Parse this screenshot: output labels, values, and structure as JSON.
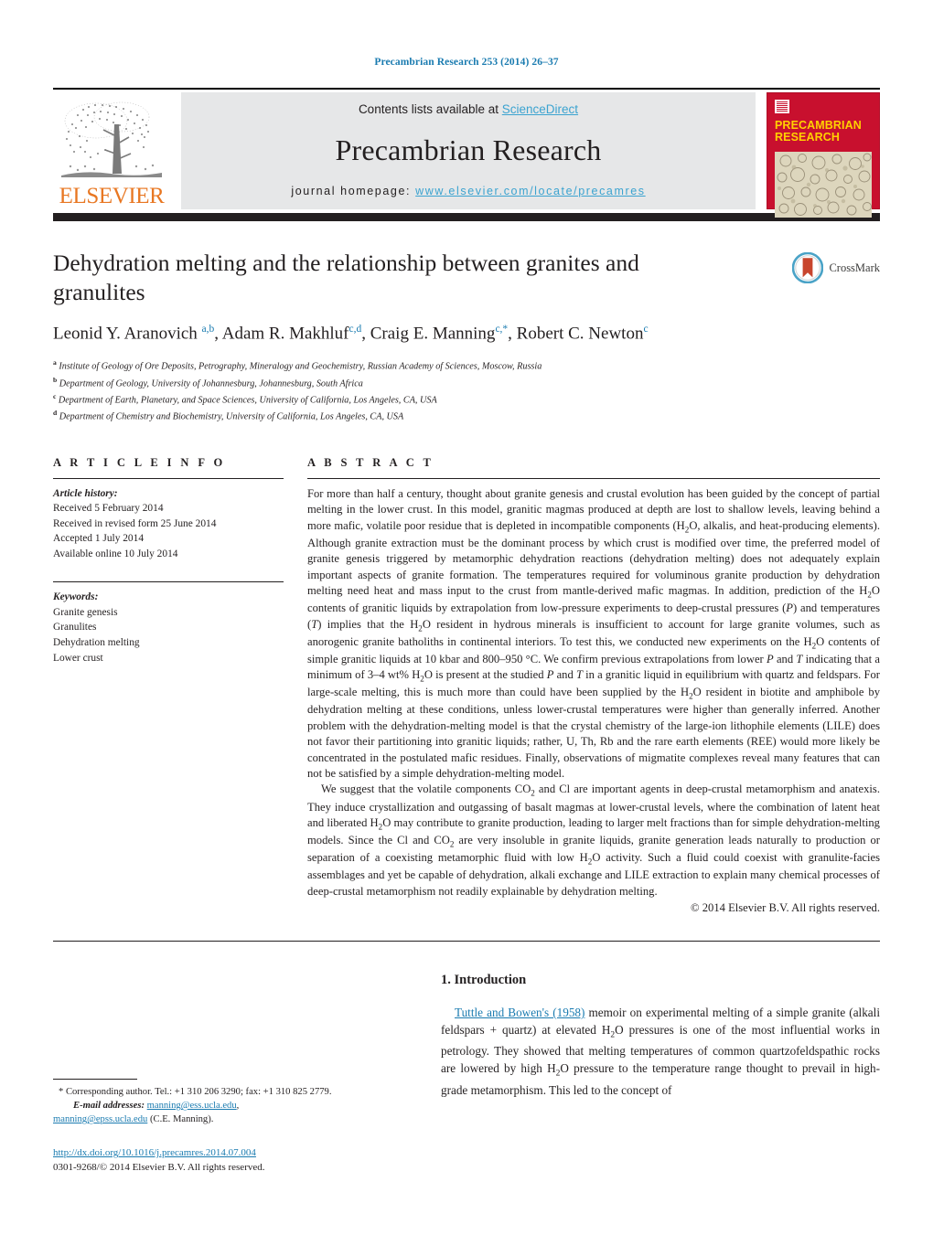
{
  "running_head": "Precambrian Research 253 (2014) 26–37",
  "masthead": {
    "publisher_name": "ELSEVIER",
    "contents_prefix": "Contents lists available at ",
    "sciencedirect_label": "ScienceDirect",
    "journal_title": "Precambrian Research",
    "homepage_prefix": "journal homepage: ",
    "homepage_url": "www.elsevier.com/locate/precamres",
    "cover_title_line1": "PRECAMBRIAN",
    "cover_title_line2": "RESEARCH",
    "colors": {
      "cover_red": "#c8102e",
      "cover_yellow": "#ffd100",
      "elsevier_orange": "#e87722",
      "link_blue": "#3ba3d0",
      "panel_gray": "#e6e7e8"
    }
  },
  "article": {
    "title": "Dehydration melting and the relationship between granites and granulites",
    "authors_html": "Leonid Y. Aranovich <sup>a,b</sup>, Adam R. Makhluf<sup>c,d</sup>, Craig E. Manning<sup>c,</sup><sup>*</sup>, Robert C. Newton<sup>c</sup>",
    "affiliations": [
      {
        "marker": "a",
        "text": "Institute of Geology of Ore Deposits, Petrography, Mineralogy and Geochemistry, Russian Academy of Sciences, Moscow, Russia"
      },
      {
        "marker": "b",
        "text": "Department of Geology, University of Johannesburg, Johannesburg, South Africa"
      },
      {
        "marker": "c",
        "text": "Department of Earth, Planetary, and Space Sciences, University of California, Los Angeles, CA, USA"
      },
      {
        "marker": "d",
        "text": "Department of Chemistry and Biochemistry, University of California, Los Angeles, CA, USA"
      }
    ],
    "crossmark_label": "CrossMark"
  },
  "article_info": {
    "kicker": "A R T I C L E   I N F O",
    "history_head": "Article history:",
    "history": [
      "Received 5 February 2014",
      "Received in revised form 25 June 2014",
      "Accepted 1 July 2014",
      "Available online 10 July 2014"
    ],
    "keywords_head": "Keywords:",
    "keywords": [
      "Granite genesis",
      "Granulites",
      "Dehydration melting",
      "Lower crust"
    ]
  },
  "abstract": {
    "kicker": "A B S T R A C T",
    "paragraph1_html": "For more than half a century, thought about granite genesis and crustal evolution has been guided by the concept of partial melting in the lower crust. In this model, granitic magmas produced at depth are lost to shallow levels, leaving behind a more mafic, volatile poor residue that is depleted in incompatible components (H<sub>2</sub>O, alkalis, and heat-producing elements). Although granite extraction must be the dominant process by which crust is modified over time, the preferred model of granite genesis triggered by metamorphic dehydration reactions (dehydration melting) does not adequately explain important aspects of granite formation. The temperatures required for voluminous granite production by dehydration melting need heat and mass input to the crust from mantle-derived mafic magmas. In addition, prediction of the H<sub>2</sub>O contents of granitic liquids by extrapolation from low-pressure experiments to deep-crustal pressures (<i>P</i>) and temperatures (<i>T</i>) implies that the H<sub>2</sub>O resident in hydrous minerals is insufficient to account for large granite volumes, such as anorogenic granite batholiths in continental interiors. To test this, we conducted new experiments on the H<sub>2</sub>O contents of simple granitic liquids at 10 kbar and 800–950 &deg;C. We confirm previous extrapolations from lower <i>P</i> and <i>T</i> indicating that a minimum of 3–4 wt% H<sub>2</sub>O is present at the studied <i>P</i> and <i>T</i> in a granitic liquid in equilibrium with quartz and feldspars. For large-scale melting, this is much more than could have been supplied by the H<sub>2</sub>O resident in biotite and amphibole by dehydration melting at these conditions, unless lower-crustal temperatures were higher than generally inferred. Another problem with the dehydration-melting model is that the crystal chemistry of the large-ion lithophile elements (LILE) does not favor their partitioning into granitic liquids; rather, U, Th, Rb and the rare earth elements (REE) would more likely be concentrated in the postulated mafic residues. Finally, observations of migmatite complexes reveal many features that can not be satisfied by a simple dehydration-melting model.",
    "paragraph2_html": "We suggest that the volatile components CO<sub>2</sub> and Cl are important agents in deep-crustal metamorphism and anatexis. They induce crystallization and outgassing of basalt magmas at lower-crustal levels, where the combination of latent heat and liberated H<sub>2</sub>O may contribute to granite production, leading to larger melt fractions than for simple dehydration-melting models. Since the Cl and CO<sub>2</sub> are very insoluble in granite liquids, granite generation leads naturally to production or separation of a coexisting metamorphic fluid with low H<sub>2</sub>O activity. Such a fluid could coexist with granulite-facies assemblages and yet be capable of dehydration, alkali exchange and LILE extraction to explain many chemical processes of deep-crustal metamorphism not readily explainable by dehydration melting.",
    "copyright": "© 2014 Elsevier B.V. All rights reserved."
  },
  "body": {
    "section_heading": "1. Introduction",
    "intro_cite": "Tuttle and Bowen's (1958)",
    "intro_rest_html": " memoir on experimental melting of a simple granite (alkali feldspars + quartz) at elevated H<sub>2</sub>O pressures is one of the most influential works in petrology. They showed that melting temperatures of common quartzofeldspathic rocks are lowered by high H<sub>2</sub>O pressure to the temperature range thought to prevail in high-grade metamorphism. This led to the concept of"
  },
  "footnotes": {
    "corresponding_html": "* Corresponding author. Tel.: +1 310 206 3290; fax: +1 310 825 2779.",
    "email_label": "E-mail addresses:",
    "email1": "manning@ess.ucla.edu",
    "email2": "manning@epss.ucla.edu",
    "email_owner": "(C.E. Manning).",
    "doi_url": "http://dx.doi.org/10.1016/j.precamres.2014.07.004",
    "issn_line": "0301-9268/© 2014 Elsevier B.V. All rights reserved."
  }
}
